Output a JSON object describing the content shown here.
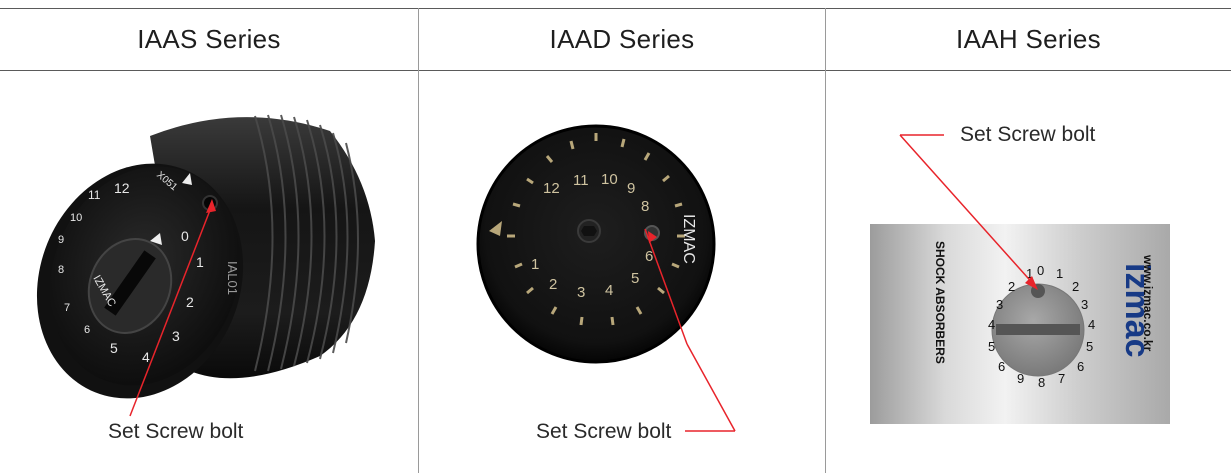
{
  "columns": [
    {
      "title": "IAAS Series",
      "callout": "Set Screw bolt"
    },
    {
      "title": "IAAD Series",
      "callout": "Set Screw bolt"
    },
    {
      "title": "IAAH Series",
      "callout": "Set Screw bolt"
    }
  ],
  "iaas_dial": {
    "numbers": [
      "0",
      "1",
      "2",
      "3",
      "4",
      "5",
      "6",
      "7",
      "8",
      "9",
      "10",
      "11",
      "12"
    ],
    "brand": "IZMAC",
    "model": "IAL01",
    "part": "X051"
  },
  "iaad_dial": {
    "numbers": [
      "12",
      "11",
      "10",
      "9",
      "8",
      "6",
      "5",
      "4",
      "3",
      "2",
      "1"
    ],
    "brand": "IZMAC"
  },
  "iaah_plate": {
    "dial_numbers": [
      "0",
      "1",
      "2",
      "3",
      "4",
      "5",
      "6",
      "7",
      "8",
      "9",
      "1",
      "2",
      "3",
      "4",
      "5",
      "6"
    ],
    "side_text": "SHOCK ABSORBERS",
    "brand": "izmac",
    "website": "www.izmac.co.kr"
  },
  "colors": {
    "callout_line": "#e8242b",
    "rule": "#5a5a5a"
  }
}
